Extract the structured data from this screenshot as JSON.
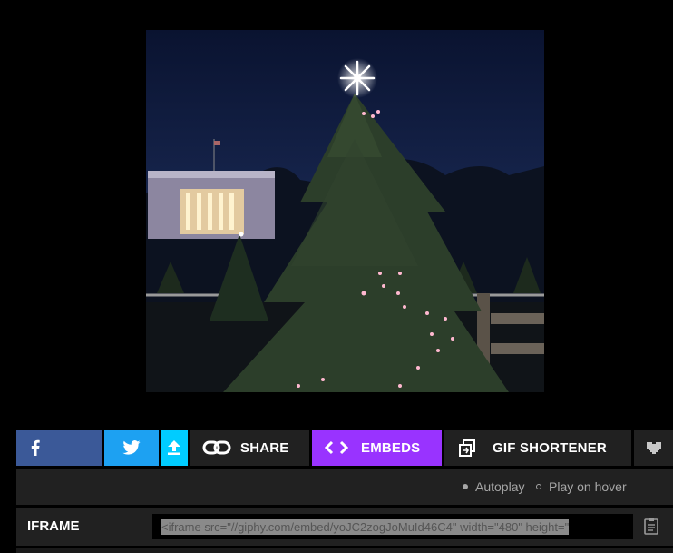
{
  "gif": {
    "alt_description_icon": "christmas-tree-gif"
  },
  "toolbar": {
    "facebook_icon": "facebook-icon",
    "twitter_icon": "twitter-icon",
    "upload_icon": "upload-icon",
    "share_label": "SHARE",
    "embeds_label": "EMBEDS",
    "shortener_label": "GIF SHORTENER",
    "colors": {
      "facebook": "#3b5998",
      "twitter": "#1da1f2",
      "upload": "#00ccff",
      "embeds": "#9933ff",
      "dark": "#212121"
    }
  },
  "options": {
    "autoplay_label": "Autoplay",
    "hover_label": "Play on hover",
    "selected": "Autoplay"
  },
  "embed": {
    "label": "IFRAME",
    "code": "<iframe src=\"//giphy.com/embed/yoJC2zogJoMuId46C4\" width=\"480\" height=\""
  }
}
